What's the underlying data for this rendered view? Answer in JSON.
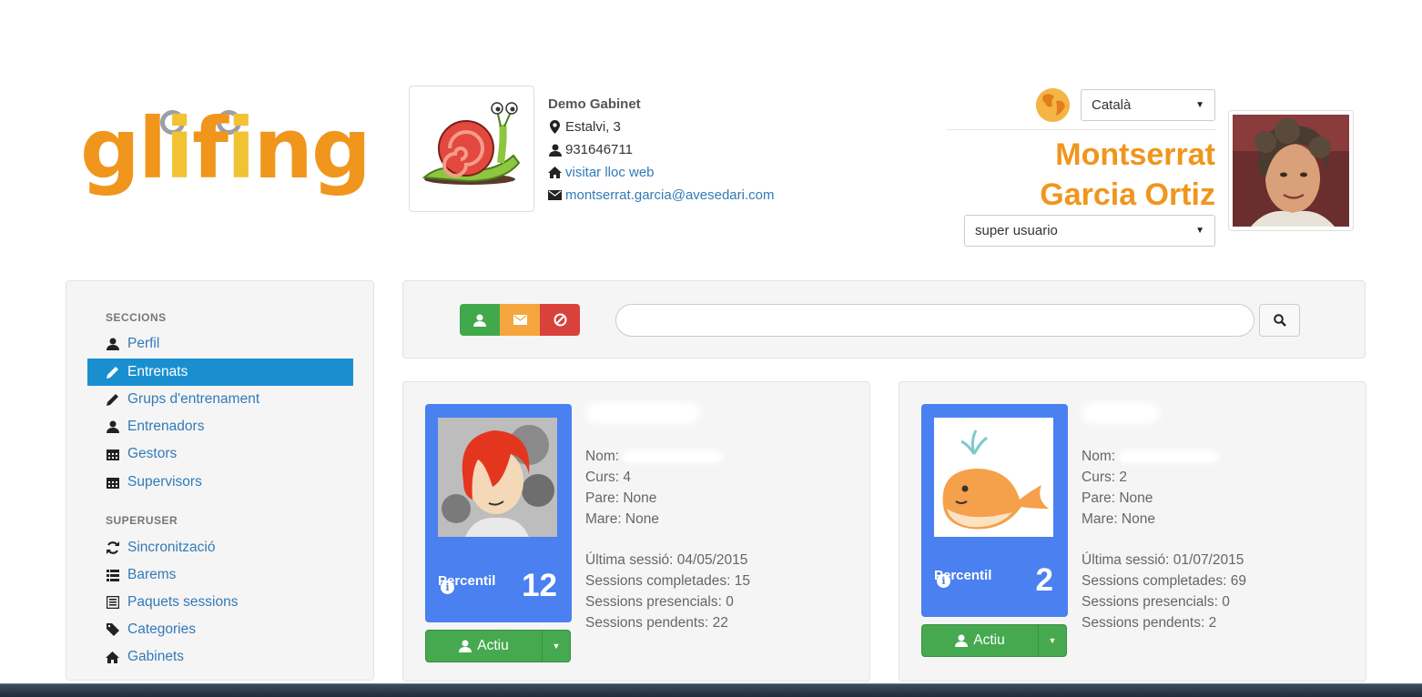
{
  "brand": {
    "logo_text": "glifing"
  },
  "center": {
    "name": "Demo Gabinet",
    "address": "Estalvi, 3",
    "phone": "931646711",
    "website_label": "visitar lloc web",
    "email": "montserrat.garcia@avesedari.com"
  },
  "user": {
    "language": "Català",
    "name_line1": "Montserrat",
    "name_line2": "Garcia Ortiz",
    "role": "super usuario"
  },
  "sidebar": {
    "header_sections": "SECCIONS",
    "header_superuser": "SUPERUSER",
    "items": [
      {
        "label": "Perfil",
        "icon": "user-icon"
      },
      {
        "label": "Entrenats",
        "icon": "pencil-icon"
      },
      {
        "label": "Grups d'entrenament",
        "icon": "pencil-icon"
      },
      {
        "label": "Entrenadors",
        "icon": "user-icon"
      },
      {
        "label": "Gestors",
        "icon": "calendar-icon"
      },
      {
        "label": "Supervisors",
        "icon": "calendar-icon"
      },
      {
        "label": "Sincronització",
        "icon": "refresh-icon"
      },
      {
        "label": "Barems",
        "icon": "list-icon"
      },
      {
        "label": "Paquets sessions",
        "icon": "list-alt-icon"
      },
      {
        "label": "Categories",
        "icon": "tag-icon"
      },
      {
        "label": "Gabinets",
        "icon": "home-icon"
      }
    ],
    "active": "Entrenats"
  },
  "toolbar": {
    "search_value": "",
    "colors": {
      "green": "#3fa94b",
      "orange": "#f5a53d",
      "red": "#d9413b"
    }
  },
  "cards": [
    {
      "percentile_label": "Percentil",
      "percentile_value": "12",
      "nom": "Nom:",
      "curs": "Curs: 4",
      "pare": "Pare: None",
      "mare": "Mare: None",
      "ultima": "Última sessió: 04/05/2015",
      "completades": "Sessions completades: 15",
      "presencials": "Sessions presencials: 0",
      "pendents": "Sessions pendents: 22",
      "status": "Actiu"
    },
    {
      "percentile_label": "Percentil",
      "percentile_value": "2",
      "nom": "Nom:",
      "curs": "Curs: 2",
      "pare": "Pare: None",
      "mare": "Mare: None",
      "ultima": "Última sessió: 01/07/2015",
      "completades": "Sessions completades: 69",
      "presencials": "Sessions presencials: 0",
      "pendents": "Sessions pendents: 2",
      "status": "Actiu"
    }
  ]
}
